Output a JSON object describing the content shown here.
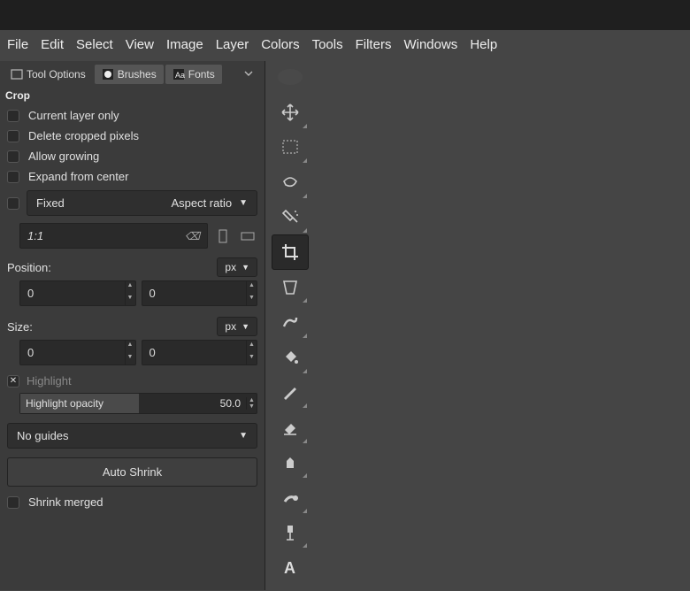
{
  "menu": [
    "File",
    "Edit",
    "Select",
    "View",
    "Image",
    "Layer",
    "Colors",
    "Tools",
    "Filters",
    "Windows",
    "Help"
  ],
  "tabs": {
    "tool_options": "Tool Options",
    "brushes": "Brushes",
    "fonts": "Fonts"
  },
  "section_title": "Crop",
  "options": {
    "current_layer": "Current layer only",
    "delete_cropped": "Delete cropped pixels",
    "allow_growing": "Allow growing",
    "expand_center": "Expand from center"
  },
  "fixed_label": "Fixed",
  "fixed_mode": "Aspect ratio",
  "ratio_value": "1:1",
  "position_label": "Position:",
  "size_label": "Size:",
  "unit": "px",
  "position": {
    "x": "0",
    "y": "0"
  },
  "size": {
    "w": "0",
    "h": "0"
  },
  "highlight_label": "Highlight",
  "highlight_checked": true,
  "opacity_label": "Highlight opacity",
  "opacity_value": "50.0",
  "guides": "No guides",
  "auto_shrink": "Auto Shrink",
  "shrink_merged": "Shrink merged",
  "tool_icons": [
    "move",
    "rect-select",
    "free-select",
    "fuzzy-select",
    "crop",
    "transform",
    "warp",
    "bucket",
    "paintbrush",
    "eraser",
    "clone",
    "smudge",
    "paths",
    "text"
  ]
}
